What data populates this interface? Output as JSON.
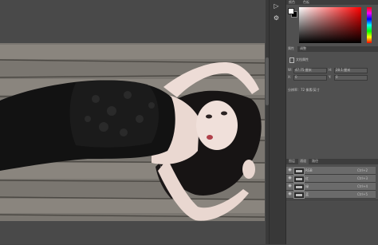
{
  "panels": {
    "color": {
      "tabs": [
        "颜色",
        "色板"
      ],
      "foreground": "#ffffff",
      "background": "#000000"
    },
    "properties": {
      "tabs": [
        "属性",
        "调整"
      ],
      "doc_label": "文档属性",
      "width_label": "W:",
      "width_value": "47.75 厘米",
      "height_label": "H:",
      "height_value": "28.1 厘米",
      "x_label": "X:",
      "x_value": "0",
      "y_label": "Y:",
      "y_value": "0",
      "resolution": "分辨率：72 像素/英寸"
    },
    "layers": {
      "tabs": [
        "图层",
        "通道",
        "路径"
      ],
      "channels": [
        {
          "name": "RGB",
          "shortcut": "Ctrl+2"
        },
        {
          "name": "红",
          "shortcut": "Ctrl+3"
        },
        {
          "name": "绿",
          "shortcut": "Ctrl+4"
        },
        {
          "name": "蓝",
          "shortcut": "Ctrl+5"
        }
      ]
    }
  },
  "tools": [
    "play-icon",
    "adjust-icon"
  ],
  "colors": {
    "canvas_bg": "#494949",
    "panel_bg": "#505050",
    "selected_row": "#6b6b6b"
  }
}
